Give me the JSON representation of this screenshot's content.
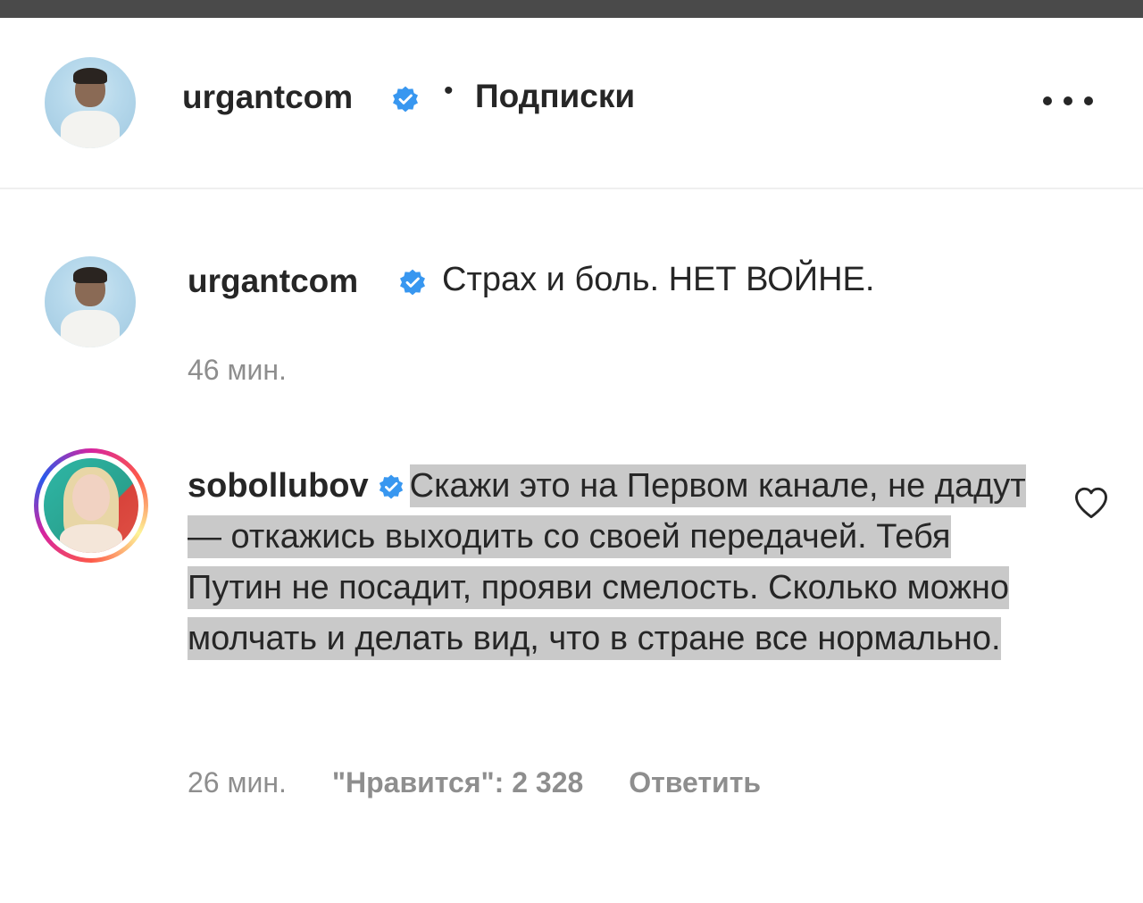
{
  "header": {
    "username": "urgantcom",
    "separator": "•",
    "follow_status": "Подписки"
  },
  "caption": {
    "username": "urgantcom",
    "text": "Страх и боль. НЕТ ВОЙНЕ.",
    "time": "46 мин."
  },
  "comment": {
    "username": "sobollubov",
    "text": "Скажи это на Первом канале, не дадут — откажись выходить со своей передачей. Тебя Путин не посадит, прояви смелость. Сколько можно молчать и делать вид, что в стране все нормально.",
    "time": "26 мин.",
    "likes": "\"Нравится\": 2 328",
    "reply_label": "Ответить"
  },
  "icons": {
    "verified": "verified-badge-icon",
    "more": "more-options-icon",
    "like": "heart-icon"
  },
  "colors": {
    "verified": "#3897f0",
    "text": "#262626",
    "muted": "#8e8e8e",
    "highlight": "#c9c9c9"
  }
}
